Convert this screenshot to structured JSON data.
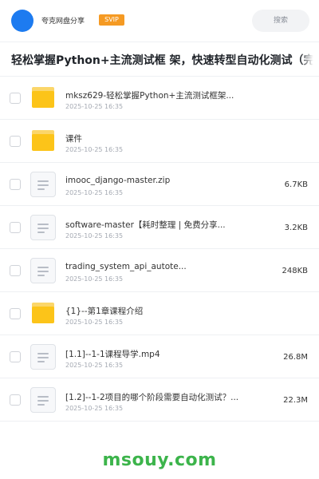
{
  "header": {
    "user_name": "夸克网盘分享",
    "badge": "SVIP",
    "search_label": "搜索"
  },
  "title": "轻松掌握Python+主流测试框 架，快速转型自动化测试（完结）",
  "files": [
    {
      "name": "mksz629-轻松掌握Python+主流测试框架...",
      "date": "2025-10-25 16:35",
      "size": "",
      "icon": "folder-icon"
    },
    {
      "name": "课件",
      "date": "2025-10-25 16:35",
      "size": "",
      "icon": "folder-icon"
    },
    {
      "name": "imooc_django-master.zip",
      "date": "2025-10-25 16:35",
      "size": "6.7KB",
      "icon": "file-icon"
    },
    {
      "name": "software-master【耗时整理 | 免费分享...",
      "date": "2025-10-25 16:35",
      "size": "3.2KB",
      "icon": "file-icon"
    },
    {
      "name": "trading_system_api_autote...",
      "date": "2025-10-25 16:35",
      "size": "248KB",
      "icon": "file-icon"
    },
    {
      "name": "{1}--第1章课程介绍",
      "date": "2025-10-25 16:35",
      "size": "",
      "icon": "folder-icon"
    },
    {
      "name": "[1.1]--1-1课程导学.mp4",
      "date": "2025-10-25 16:35",
      "size": "26.8M",
      "icon": "file-icon"
    },
    {
      "name": "[1.2]--1-2项目的哪个阶段需要自动化测试？...",
      "date": "2025-10-25 16:35",
      "size": "22.3M",
      "icon": "file-icon"
    }
  ],
  "footer": {
    "watermark": "msouy.com"
  },
  "colors": {
    "accent": "#1d7bf0",
    "svip": "#f59a23",
    "folder": "#fcc419",
    "watermark": "#3cb44b"
  }
}
